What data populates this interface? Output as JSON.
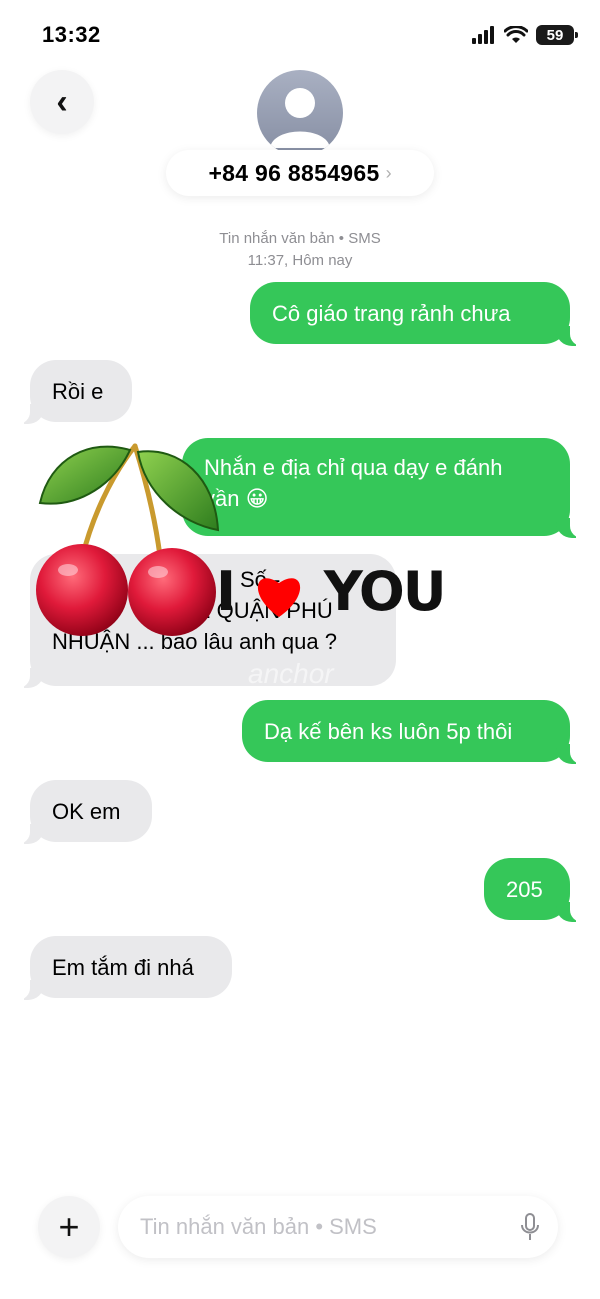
{
  "status_bar": {
    "time": "13:32",
    "battery": "59"
  },
  "header": {
    "back_label": "‹",
    "contact_number": "+84 96 8854965",
    "contact_chevron": "›"
  },
  "thread": {
    "service_label": "Tin nhắn văn bản • SMS",
    "timestamp": "11:37, Hôm nay"
  },
  "messages": [
    {
      "direction": "out",
      "text": "Cô giáo trang rảnh chưa"
    },
    {
      "direction": "in",
      "text": "Rồi e"
    },
    {
      "direction": "out",
      "line1": "Nhắn e địa chỉ qua dạy e đánh",
      "line2": "vần 😀"
    },
    {
      "direction": "in",
      "line1": "Số -",
      "line2": "NC P 2 QUẬN PHÚ",
      "line3": "NHUẬN  ... bao lâu anh qua ?"
    },
    {
      "direction": "out",
      "text": "Dạ kế bên ks luôn 5p thôi"
    },
    {
      "direction": "in",
      "text": "OK em"
    },
    {
      "direction": "out",
      "text": "205"
    },
    {
      "direction": "in",
      "text": "Em tắm đi nhá"
    }
  ],
  "stickers": {
    "cherry": "cherry-sticker",
    "text": "I",
    "text2": "YOU"
  },
  "watermark": "anchor",
  "composer": {
    "plus_label": "+",
    "placeholder": "Tin nhắn văn bản • SMS"
  },
  "colors": {
    "outgoing": "#35c759",
    "incoming": "#e9e9eb",
    "avatar": "#9aa1b5"
  }
}
